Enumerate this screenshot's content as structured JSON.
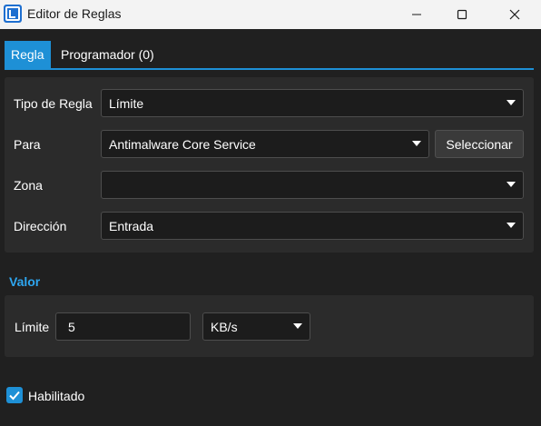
{
  "window": {
    "title": "Editor de Reglas"
  },
  "tabs": [
    {
      "label": "Regla"
    },
    {
      "label": "Programador (0)"
    }
  ],
  "rule": {
    "type_label": "Tipo de Regla",
    "type_value": "Límite",
    "for_label": "Para",
    "for_value": "Antimalware Core Service",
    "select_button": "Seleccionar",
    "zone_label": "Zona",
    "zone_value": "",
    "direction_label": "Dirección",
    "direction_value": "Entrada"
  },
  "value_section": {
    "title": "Valor",
    "limit_label": "Límite",
    "limit_value": "5",
    "unit_value": "KB/s"
  },
  "enabled": {
    "label": "Habilitado",
    "checked": true
  },
  "colors": {
    "accent": "#1e90d6",
    "section_title": "#2ea6f0",
    "background": "#202020",
    "panel": "#2b2b2b"
  }
}
